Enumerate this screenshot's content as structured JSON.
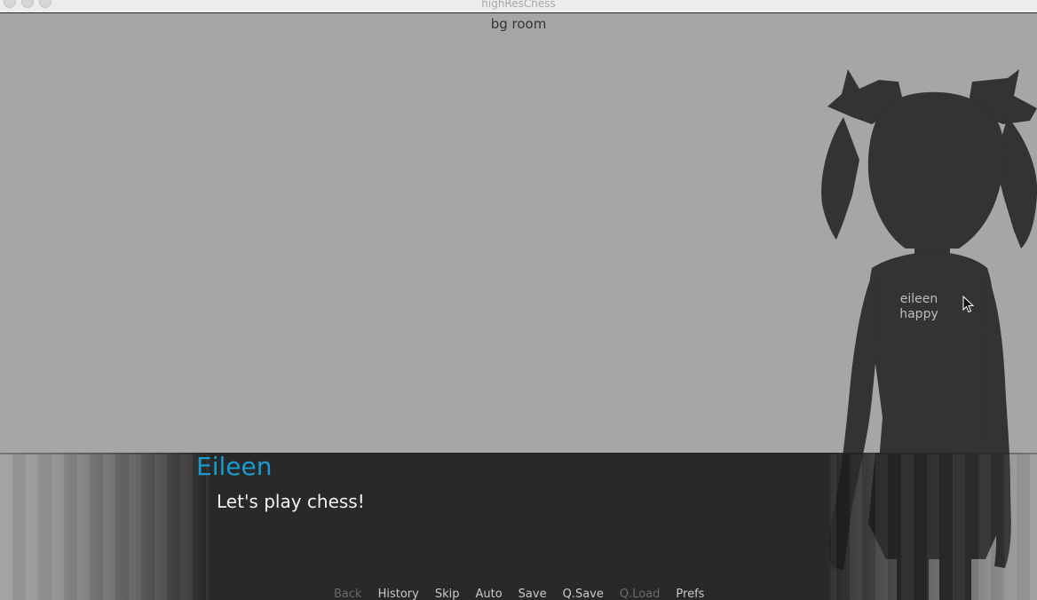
{
  "window": {
    "title": "highResChess"
  },
  "scene": {
    "background_label": "bg room"
  },
  "character": {
    "label_line1": "eileen",
    "label_line2": "happy"
  },
  "dialogue": {
    "speaker": "Eileen",
    "speaker_color": "#1a9bd0",
    "text": "Let's play chess!"
  },
  "quick_menu": {
    "items": [
      {
        "label": "Back",
        "enabled": false
      },
      {
        "label": "History",
        "enabled": true
      },
      {
        "label": "Skip",
        "enabled": true
      },
      {
        "label": "Auto",
        "enabled": true
      },
      {
        "label": "Save",
        "enabled": true
      },
      {
        "label": "Q.Save",
        "enabled": true
      },
      {
        "label": "Q.Load",
        "enabled": false
      },
      {
        "label": "Prefs",
        "enabled": true
      }
    ]
  }
}
